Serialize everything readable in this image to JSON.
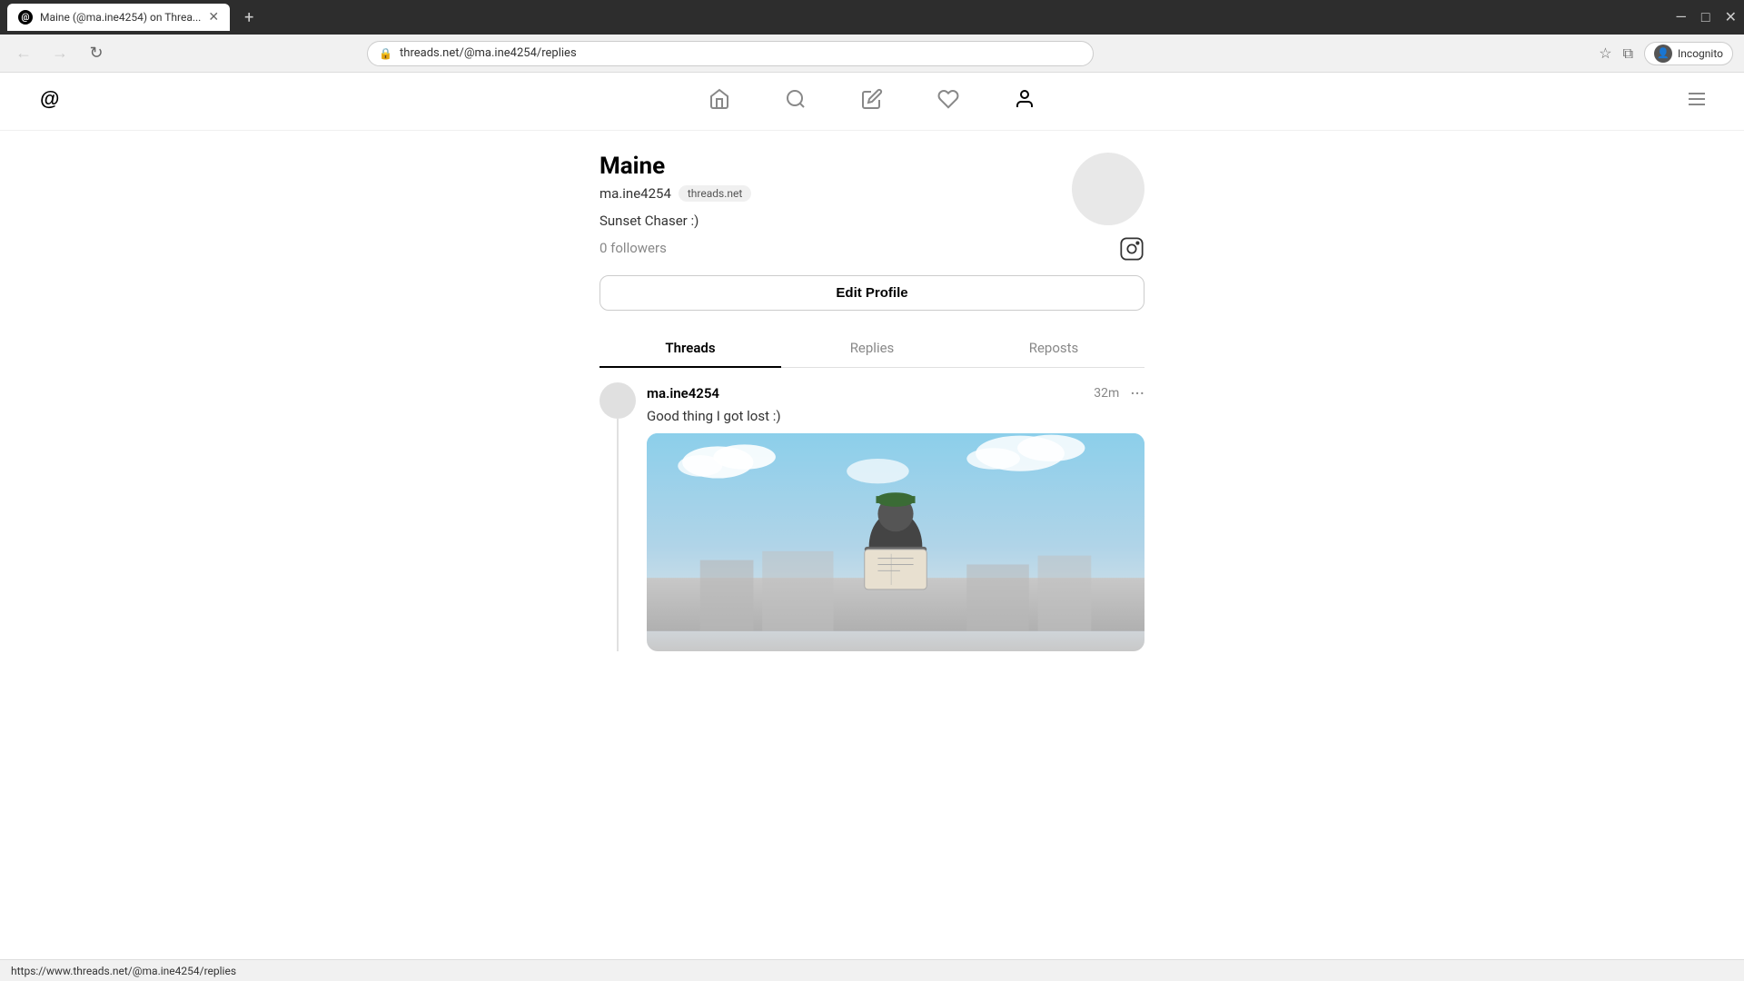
{
  "browser": {
    "tab_title": "Maine (@ma.ine4254) on Threa...",
    "tab_favicon": "@",
    "url": "threads.net/@ma.ine4254/replies",
    "new_tab_label": "+",
    "window_controls": [
      "—",
      "□",
      "✕"
    ],
    "incognito_label": "Incognito"
  },
  "nav": {
    "logo": "@",
    "icons": {
      "home": "⌂",
      "search": "🔍",
      "compose": "✏",
      "heart": "♡",
      "profile": "👤"
    },
    "hamburger": "≡"
  },
  "profile": {
    "name": "Maine",
    "handle": "ma.ine4254",
    "badge": "threads.net",
    "bio": "Sunset Chaser :)",
    "followers": "0 followers",
    "edit_button": "Edit Profile",
    "tabs": [
      {
        "label": "Threads",
        "active": true
      },
      {
        "label": "Replies",
        "active": false
      },
      {
        "label": "Reposts",
        "active": false
      }
    ]
  },
  "post": {
    "username": "ma.ine4254",
    "time": "32m",
    "text": "Good thing I got lost :)",
    "more_icon": "···"
  },
  "status_bar": {
    "url": "https://www.threads.net/@ma.ine4254/replies"
  }
}
